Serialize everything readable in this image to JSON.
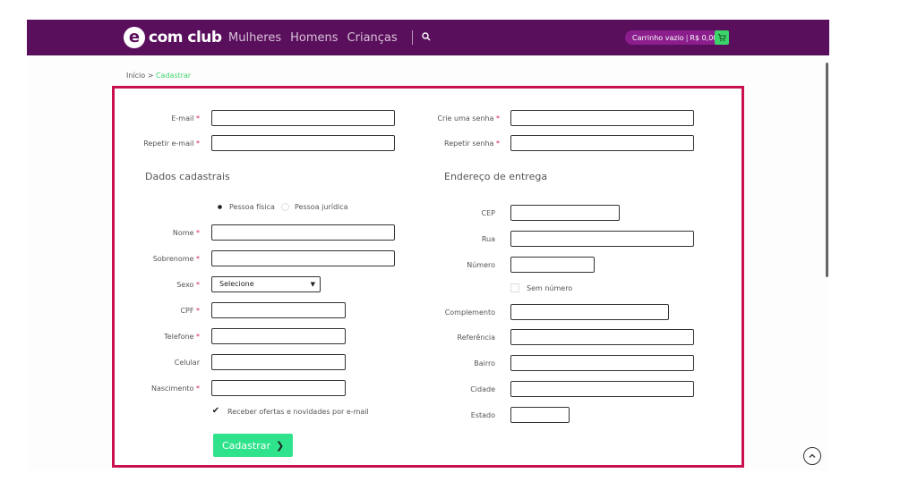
{
  "header": {
    "logo_mark": "e",
    "logo_text": "com club",
    "nav": [
      "Mulheres",
      "Homens",
      "Crianças"
    ],
    "search_icon": "search-icon",
    "cart_text": "Carrinho vazio",
    "cart_total": "R$ 0,00",
    "cart_icon": "cart-icon"
  },
  "breadcrumb": {
    "home": "Início",
    "separator": ">",
    "current": "Cadastrar"
  },
  "account": {
    "email_label": "E-mail",
    "repeat_email_label": "Repetir e-mail",
    "password_label": "Crie uma senha",
    "repeat_password_label": "Repetir senha",
    "required_mark": "*"
  },
  "dados": {
    "title": "Dados cadastrais",
    "person_type": [
      "Pessoa física",
      "Pessoa jurídica"
    ],
    "selected_person_type": "Pessoa física",
    "nome_label": "Nome",
    "sobrenome_label": "Sobrenome",
    "sexo_label": "Sexo",
    "sexo_value": "Selecione",
    "cpf_label": "CPF",
    "telefone_label": "Telefone",
    "celular_label": "Celular",
    "nascimento_label": "Nascimento",
    "newsletter_label": "Receber ofertas e novidades por e-mail",
    "newsletter_checked": true,
    "submit_label": "Cadastrar"
  },
  "endereco": {
    "title": "Endereço de entrega",
    "cep_label": "CEP",
    "rua_label": "Rua",
    "numero_label": "Número",
    "sem_numero_label": "Sem número",
    "complemento_label": "Complemento",
    "referencia_label": "Referência",
    "bairro_label": "Bairro",
    "cidade_label": "Cidade",
    "estado_label": "Estado"
  },
  "colors": {
    "header": "#5a0f5c",
    "accent": "#3bd46a",
    "frame": "#c8114e",
    "button": "#2ee38b"
  }
}
